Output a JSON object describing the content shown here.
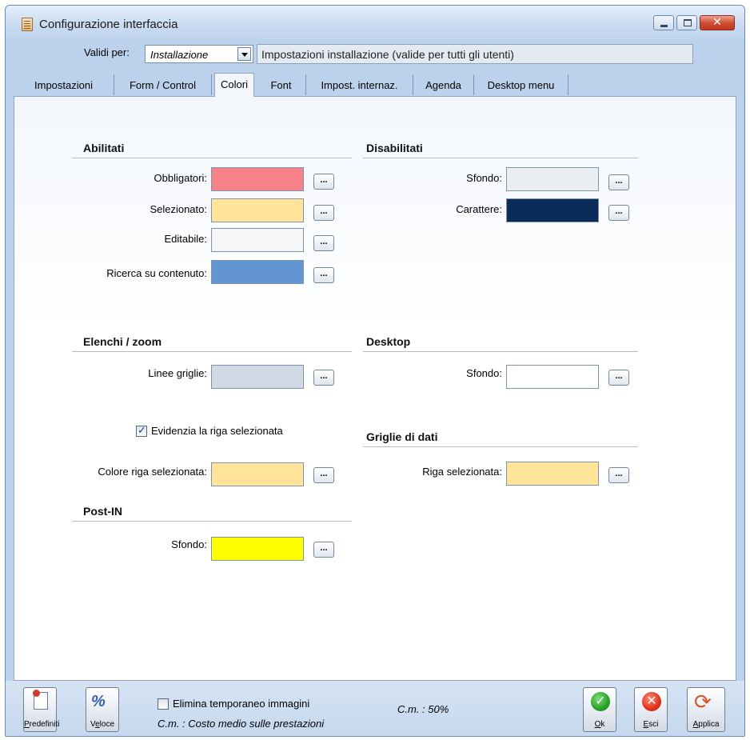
{
  "window": {
    "title": "Configurazione interfaccia"
  },
  "header": {
    "valid_label": "Validi per:",
    "valid_value": "Installazione",
    "description": "Impostazioni installazione (valide per tutti gli utenti)"
  },
  "tabs": [
    {
      "label": "Impostazioni"
    },
    {
      "label": "Form / Control"
    },
    {
      "label": "Colori"
    },
    {
      "label": "Font"
    },
    {
      "label": "Impost. internaz."
    },
    {
      "label": "Agenda"
    },
    {
      "label": "Desktop menu"
    }
  ],
  "active_tab": "Colori",
  "sections": {
    "abilitati": {
      "title": "Abilitati",
      "obbligatori": {
        "label": "Obbligatori:",
        "color": "#f7828a"
      },
      "selezionato": {
        "label": "Selezionato:",
        "color": "#ffe49a"
      },
      "editabile": {
        "label": "Editabile:",
        "color": "#f6f6f6"
      },
      "ricerca": {
        "label": "Ricerca su contenuto:",
        "color": "#6395d2"
      }
    },
    "disabilitati": {
      "title": "Disabilitati",
      "sfondo": {
        "label": "Sfondo:",
        "color": "#eceff2"
      },
      "carattere": {
        "label": "Carattere:",
        "color": "#0b2b59"
      }
    },
    "elenchi": {
      "title": "Elenchi / zoom",
      "linee": {
        "label": "Linee griglie:",
        "color": "#d1d9e4"
      },
      "evidenzia": {
        "label": "Evidenzia la riga selezionata",
        "checked": true
      },
      "colore_riga": {
        "label": "Colore riga selezionata:",
        "color": "#ffe49a"
      }
    },
    "desktop": {
      "title": "Desktop",
      "sfondo": {
        "label": "Sfondo:",
        "color": "#ffffff"
      }
    },
    "griglie": {
      "title": "Griglie di dati",
      "riga": {
        "label": "Riga selezionata:",
        "color": "#ffe49a"
      }
    },
    "postin": {
      "title": "Post-IN",
      "sfondo": {
        "label": "Sfondo:",
        "color": "#ffff00"
      }
    }
  },
  "browse_label": "...",
  "footer": {
    "predefiniti": {
      "key": "P",
      "rest": "redefiniti"
    },
    "veloce": {
      "pre": "V",
      "key": "e",
      "rest": "loce"
    },
    "elimina": {
      "label": "Elimina temporaneo immagini",
      "checked": false
    },
    "cm_note": "C.m. : Costo medio sulle prestazioni",
    "cm_value": "C.m. : 50%",
    "ok": {
      "key": "O",
      "rest": "k"
    },
    "esci": {
      "key": "E",
      "rest": "sci"
    },
    "applica": {
      "key": "A",
      "rest": "pplica"
    }
  }
}
